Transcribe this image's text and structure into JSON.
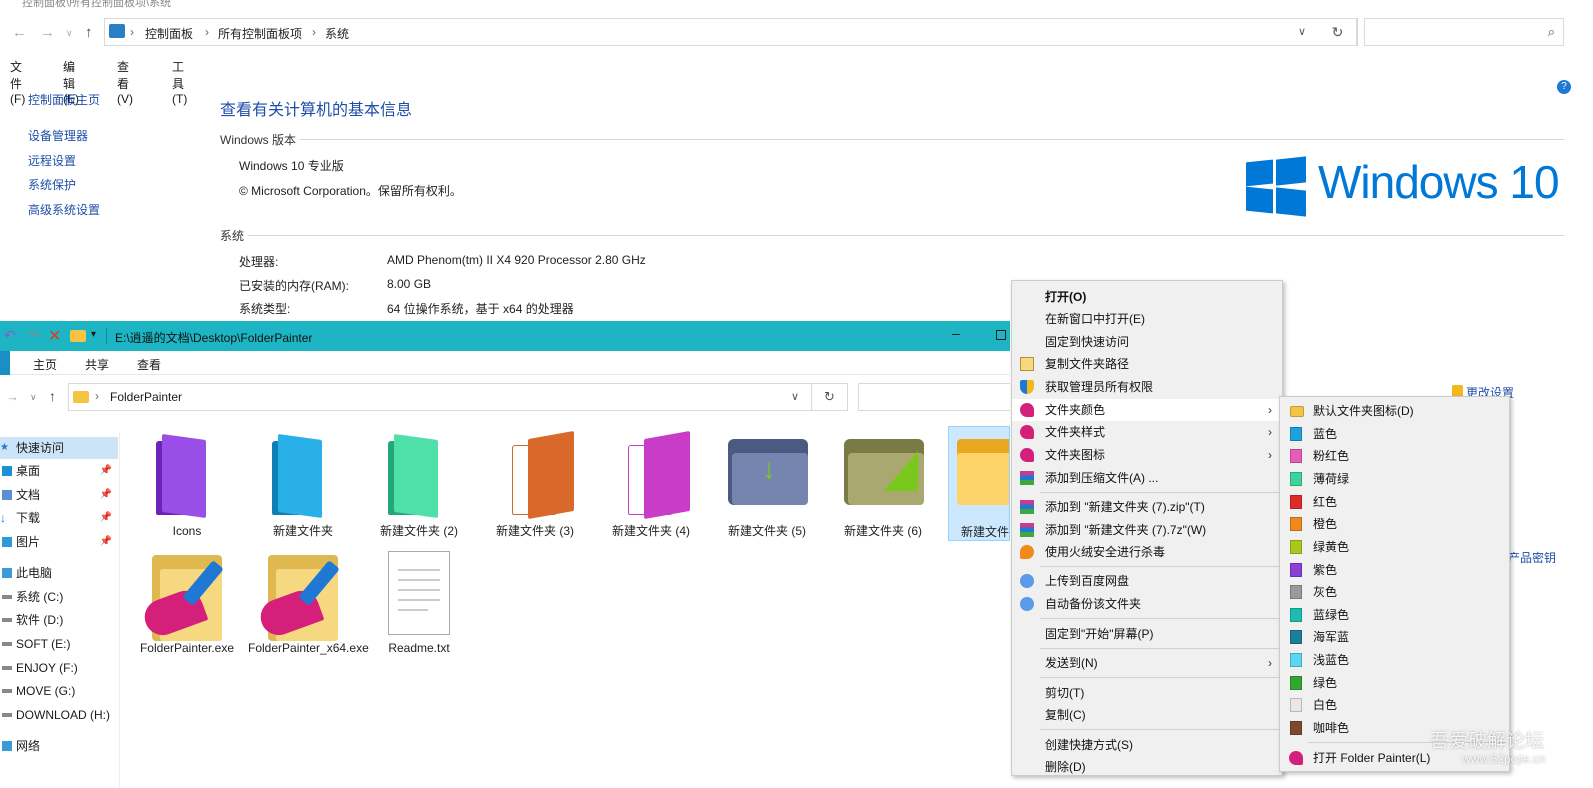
{
  "control_panel": {
    "window_title": "控制面板\\所有控制面板项\\系统",
    "breadcrumbs": [
      "控制面板",
      "所有控制面板项",
      "系统"
    ],
    "menu": [
      "文件(F)",
      "编辑(E)",
      "查看(V)",
      "工具(T)"
    ],
    "sidebar": {
      "home": "控制面板主页",
      "links": [
        "设备管理器",
        "远程设置",
        "系统保护",
        "高级系统设置"
      ]
    },
    "heading": "查看有关计算机的基本信息",
    "windows_section": {
      "title": "Windows 版本",
      "edition": "Windows 10 专业版",
      "copyright": "© Microsoft Corporation。保留所有权利。"
    },
    "logo_text": "Windows 10",
    "system_section": {
      "title": "系统",
      "rows": [
        {
          "label": "处理器:",
          "value": "AMD Phenom(tm) II X4 920 Processor   2.80 GHz"
        },
        {
          "label": "已安装的内存(RAM):",
          "value": "8.00 GB"
        },
        {
          "label": "系统类型:",
          "value": "64 位操作系统，基于 x64 的处理器"
        }
      ]
    },
    "right_links": {
      "change_settings": "更改设置",
      "product_key": "产品密钥"
    }
  },
  "explorer": {
    "title_path": "E:\\逍遥的文档\\Desktop\\FolderPainter",
    "tabs": [
      "主页",
      "共享",
      "查看"
    ],
    "address": "FolderPainter",
    "nav": [
      {
        "label": "快速访问",
        "pinned": false
      },
      {
        "label": "桌面",
        "pinned": true
      },
      {
        "label": "文档",
        "pinned": true
      },
      {
        "label": "下载",
        "pinned": true
      },
      {
        "label": "图片",
        "pinned": true
      },
      {
        "label": "此电脑",
        "pinned": false
      },
      {
        "label": "系统 (C:)",
        "pinned": false
      },
      {
        "label": "软件 (D:)",
        "pinned": false
      },
      {
        "label": "SOFT (E:)",
        "pinned": false
      },
      {
        "label": "ENJOY (F:)",
        "pinned": false
      },
      {
        "label": "MOVE (G:)",
        "pinned": false
      },
      {
        "label": "DOWNLOAD (H:)",
        "pinned": false
      },
      {
        "label": "网络",
        "pinned": false
      }
    ],
    "files": [
      {
        "name": "Icons",
        "color": "#8a3fd8"
      },
      {
        "name": "新建文件夹",
        "color": "#1ea1dc"
      },
      {
        "name": "新建文件夹 (2)",
        "color": "#3ed39a"
      },
      {
        "name": "新建文件夹 (3)",
        "color": "#d9692a"
      },
      {
        "name": "新建文件夹 (4)",
        "color": "#c83cc8"
      },
      {
        "name": "新建文件夹 (5)",
        "color": "#6f7fa8"
      },
      {
        "name": "新建文件夹 (6)",
        "color": "#9a9a5c"
      },
      {
        "name": "新建文件夹",
        "color": "#f5c445"
      },
      {
        "name": "FolderPainter.exe",
        "color": "#f0d070"
      },
      {
        "name": "FolderPainter_x64.exe",
        "color": "#f0d070"
      },
      {
        "name": "Readme.txt",
        "color": "#ffffff"
      }
    ]
  },
  "context_menu": {
    "items": [
      {
        "label": "打开(O)",
        "bold": true
      },
      {
        "label": "在新窗口中打开(E)"
      },
      {
        "label": "固定到快速访问"
      },
      {
        "label": "复制文件夹路径",
        "icon": "clipboard-icon"
      },
      {
        "label": "获取管理员所有权限",
        "icon": "shield-icon"
      },
      {
        "label": "文件夹颜色",
        "icon": "paintbrush-icon",
        "submenu": true
      },
      {
        "label": "文件夹样式",
        "icon": "paintbrush-icon",
        "submenu": true
      },
      {
        "label": "文件夹图标",
        "icon": "paintbrush-icon",
        "submenu": true
      },
      {
        "label": "添加到压缩文件(A) ...",
        "icon": "archive-icon"
      },
      {
        "label": "添加到 \"新建文件夹 (7).zip\"(T)",
        "icon": "archive-icon"
      },
      {
        "label": "添加到 \"新建文件夹 (7).7z\"(W)",
        "icon": "archive-icon"
      },
      {
        "label": "使用火绒安全进行杀毒",
        "icon": "flame-icon"
      },
      {
        "label": "上传到百度网盘",
        "icon": "cloud-icon"
      },
      {
        "label": "自动备份该文件夹",
        "icon": "cloud-icon"
      },
      {
        "label": "固定到\"开始\"屏幕(P)"
      },
      {
        "label": "发送到(N)",
        "submenu": true
      },
      {
        "label": "剪切(T)"
      },
      {
        "label": "复制(C)"
      },
      {
        "label": "创建快捷方式(S)"
      },
      {
        "label": "删除(D)"
      }
    ]
  },
  "color_submenu": {
    "items": [
      {
        "label": "默认文件夹图标(D)",
        "color": "#f5c445"
      },
      {
        "label": "蓝色",
        "color": "#1ea1dc"
      },
      {
        "label": "粉红色",
        "color": "#e85ab8"
      },
      {
        "label": "薄荷绿",
        "color": "#3ed39a"
      },
      {
        "label": "红色",
        "color": "#e02a2a"
      },
      {
        "label": "橙色",
        "color": "#f08a1a"
      },
      {
        "label": "绿黄色",
        "color": "#a8c81e"
      },
      {
        "label": "紫色",
        "color": "#8a3fd8"
      },
      {
        "label": "灰色",
        "color": "#9a9a9a"
      },
      {
        "label": "蓝绿色",
        "color": "#1ebcb0"
      },
      {
        "label": "海军蓝",
        "color": "#1a7f9c"
      },
      {
        "label": "浅蓝色",
        "color": "#5ad6f0"
      },
      {
        "label": "绿色",
        "color": "#2ea82e"
      },
      {
        "label": "白色",
        "color": "#e8e8e8"
      },
      {
        "label": "咖啡色",
        "color": "#7a4a2e"
      }
    ],
    "open_app": "打开 Folder Painter(L)"
  },
  "watermark": {
    "line1": "吾爱破解论坛",
    "line2": "www.52pojie.cn"
  }
}
